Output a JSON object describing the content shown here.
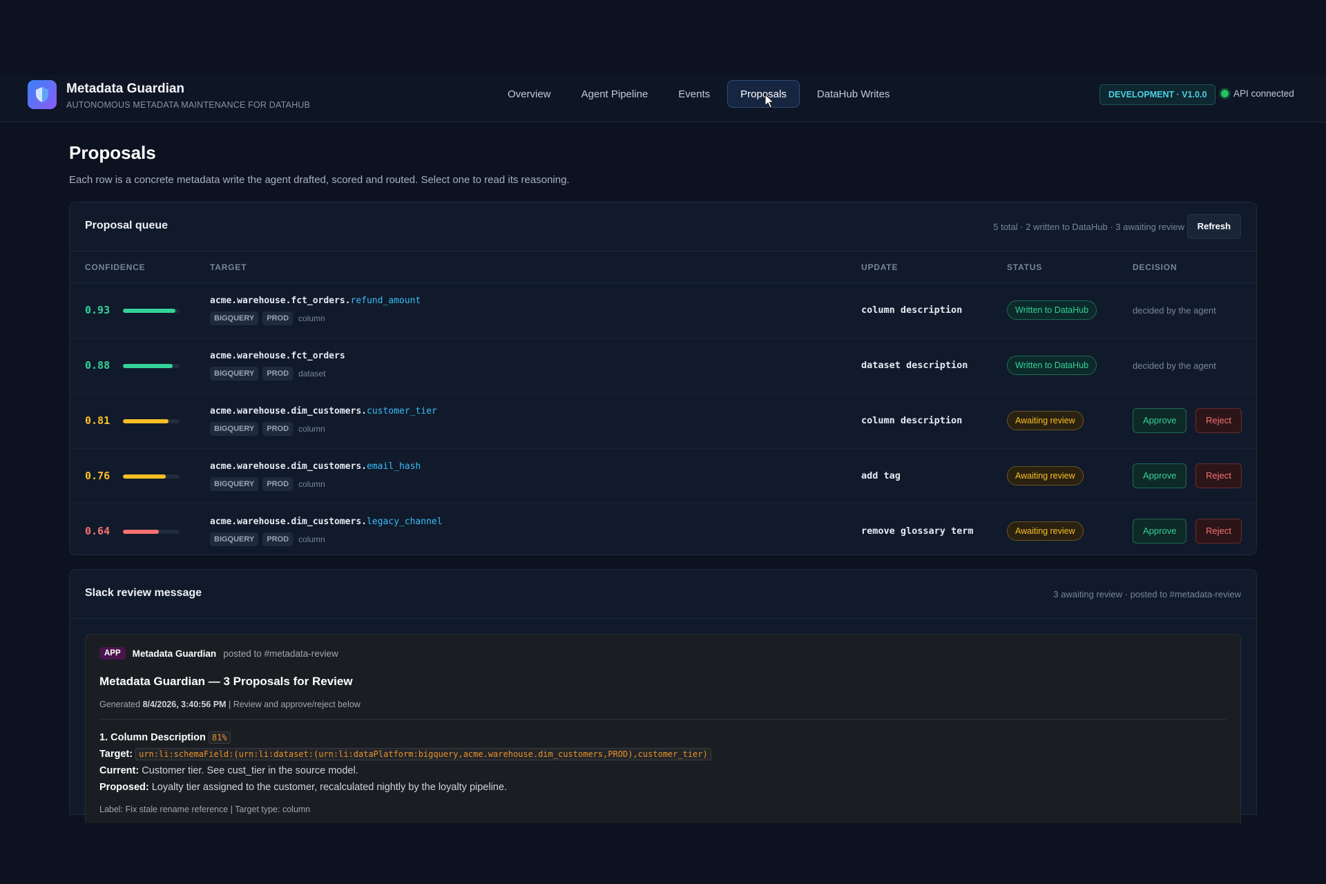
{
  "app": {
    "title": "Metadata Guardian",
    "subtitle": "AUTONOMOUS METADATA MAINTENANCE FOR DATAHUB",
    "env_badge": "DEVELOPMENT · V1.0.0",
    "api_status": "API connected"
  },
  "nav": {
    "tabs": [
      "Overview",
      "Agent Pipeline",
      "Events",
      "Proposals",
      "DataHub Writes"
    ],
    "active": "Proposals"
  },
  "page": {
    "title": "Proposals",
    "description": "Each row is a concrete metadata write the agent drafted, scored and routed. Select one to read its reasoning."
  },
  "queue": {
    "title": "Proposal queue",
    "meta": "5 total · 2 written to DataHub · 3 awaiting review",
    "refresh_label": "Refresh",
    "columns": [
      "CONFIDENCE",
      "TARGET",
      "UPDATE",
      "STATUS",
      "DECISION"
    ],
    "rows": [
      {
        "confidence": "0.93",
        "confidence_value": 0.93,
        "color": "#34d399",
        "urn": "acme.warehouse.fct_orders.",
        "field": "refund_amount",
        "platform": "BIGQUERY",
        "env": "PROD",
        "kind": "column",
        "update": "column description",
        "status": "Written to DataHub",
        "status_type": "written",
        "decision": "decided by the agent"
      },
      {
        "confidence": "0.88",
        "confidence_value": 0.88,
        "color": "#34d399",
        "urn": "acme.warehouse.fct_orders",
        "field": "",
        "platform": "BIGQUERY",
        "env": "PROD",
        "kind": "dataset",
        "update": "dataset description",
        "status": "Written to DataHub",
        "status_type": "written",
        "decision": "decided by the agent"
      },
      {
        "confidence": "0.81",
        "confidence_value": 0.81,
        "color": "#fbbf24",
        "urn": "acme.warehouse.dim_customers.",
        "field": "customer_tier",
        "platform": "BIGQUERY",
        "env": "PROD",
        "kind": "column",
        "update": "column description",
        "status": "Awaiting review",
        "status_type": "awaiting",
        "approve": "Approve",
        "reject": "Reject"
      },
      {
        "confidence": "0.76",
        "confidence_value": 0.76,
        "color": "#fbbf24",
        "urn": "acme.warehouse.dim_customers.",
        "field": "email_hash",
        "platform": "BIGQUERY",
        "env": "PROD",
        "kind": "column",
        "update": "add tag",
        "status": "Awaiting review",
        "status_type": "awaiting",
        "approve": "Approve",
        "reject": "Reject"
      },
      {
        "confidence": "0.64",
        "confidence_value": 0.64,
        "color": "#f87171",
        "urn": "acme.warehouse.dim_customers.",
        "field": "legacy_channel",
        "platform": "BIGQUERY",
        "env": "PROD",
        "kind": "column",
        "update": "remove glossary term",
        "status": "Awaiting review",
        "status_type": "awaiting",
        "approve": "Approve",
        "reject": "Reject"
      }
    ]
  },
  "slack": {
    "card_title": "Slack review message",
    "card_meta": "3 awaiting review · posted to #metadata-review",
    "app_tag": "APP",
    "sender": "Metadata Guardian",
    "posted_to": "posted to #metadata-review",
    "title": "Metadata Guardian — 3 Proposals for Review",
    "generated_prefix": "Generated",
    "generated_time": "8/4/2026, 3:40:56 PM",
    "generated_suffix": "| Review and approve/reject below",
    "item_title": "1. Column Description",
    "item_pct": "81%",
    "target_label": "Target:",
    "target_value": "urn:li:schemaField:(urn:li:dataset:(urn:li:dataPlatform:bigquery,acme.warehouse.dim_customers,PROD),customer_tier)",
    "current_label": "Current:",
    "current_value": "Customer tier. See cust_tier in the source model.",
    "proposed_label": "Proposed:",
    "proposed_value": "Loyalty tier assigned to the customer, recalculated nightly by the loyalty pipeline.",
    "footer": "Label: Fix stale rename reference | Target type: column"
  }
}
